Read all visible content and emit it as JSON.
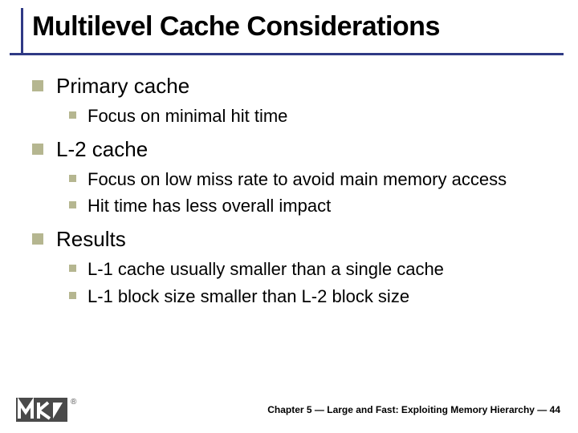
{
  "title": "Multilevel Cache Considerations",
  "bullets": [
    {
      "label": "Primary cache",
      "sub": [
        "Focus on minimal hit time"
      ]
    },
    {
      "label": "L-2 cache",
      "sub": [
        "Focus on low miss rate to avoid main memory access",
        "Hit time has less overall impact"
      ]
    },
    {
      "label": "Results",
      "sub": [
        "L-1 cache usually smaller than a single cache",
        "L-1 block size smaller than L-2 block size"
      ]
    }
  ],
  "footer": "Chapter 5 — Large and Fast: Exploiting Memory Hierarchy — 44",
  "logo_symbol": "®"
}
